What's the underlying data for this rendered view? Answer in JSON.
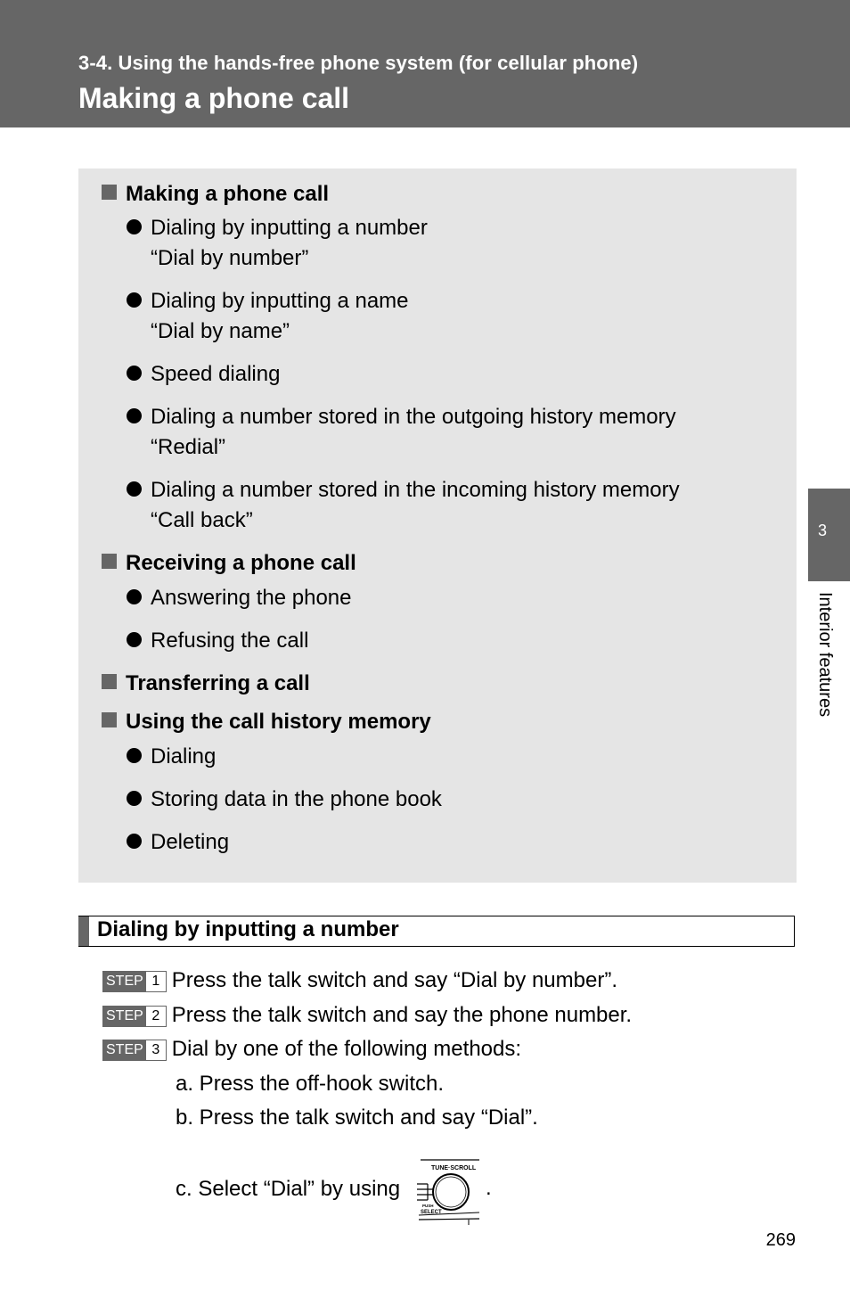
{
  "header": {
    "section": "3-4. Using the hands-free phone system (for cellular phone)",
    "title": "Making a phone call"
  },
  "summary": {
    "items": [
      {
        "type": "heading",
        "text": "Making a phone call"
      },
      {
        "type": "bullet",
        "text": "Dialing by inputting a number",
        "sub": "“Dial by number”"
      },
      {
        "type": "bullet",
        "text": "Dialing by inputting a name",
        "sub": "“Dial by name”"
      },
      {
        "type": "bullet",
        "text": "Speed dialing"
      },
      {
        "type": "bullet",
        "text": "Dialing a number stored in the outgoing history memory",
        "sub": "“Redial”"
      },
      {
        "type": "bullet",
        "text": "Dialing a number stored in the incoming history memory",
        "sub": "“Call back”"
      },
      {
        "type": "heading",
        "text": "Receiving a phone call"
      },
      {
        "type": "bullet",
        "text": "Answering the phone"
      },
      {
        "type": "bullet",
        "text": "Refusing the call"
      },
      {
        "type": "heading",
        "text": "Transferring a call"
      },
      {
        "type": "heading",
        "text": "Using the call history memory"
      },
      {
        "type": "bullet",
        "text": "Dialing"
      },
      {
        "type": "bullet",
        "text": "Storing data in the phone book"
      },
      {
        "type": "bullet",
        "text": "Deleting"
      }
    ]
  },
  "section": {
    "title": "Dialing by inputting a number",
    "step_label": "STEP",
    "steps": [
      {
        "num": "1",
        "text": "Press the talk switch and say “Dial by number”."
      },
      {
        "num": "2",
        "text": "Press the talk switch and say the phone number."
      },
      {
        "num": "3",
        "text": "Dial by one of the following methods:"
      }
    ],
    "methods": [
      "a. Press the off-hook switch.",
      "b. Press the talk switch and say “Dial”.",
      "c. Select “Dial” by using"
    ],
    "knob": {
      "icon": "tune-scroll-knob-icon",
      "top_label": "TUNE·SCROLL",
      "push_label": "PUSH",
      "select_label": "SELECT"
    },
    "period": "."
  },
  "side_tab": {
    "number": "3",
    "label": "Interior features"
  },
  "page_number": "269",
  "colors": {
    "header_bg": "#666666",
    "summary_bg": "#e5e5e5",
    "tab_bg": "#666666"
  }
}
